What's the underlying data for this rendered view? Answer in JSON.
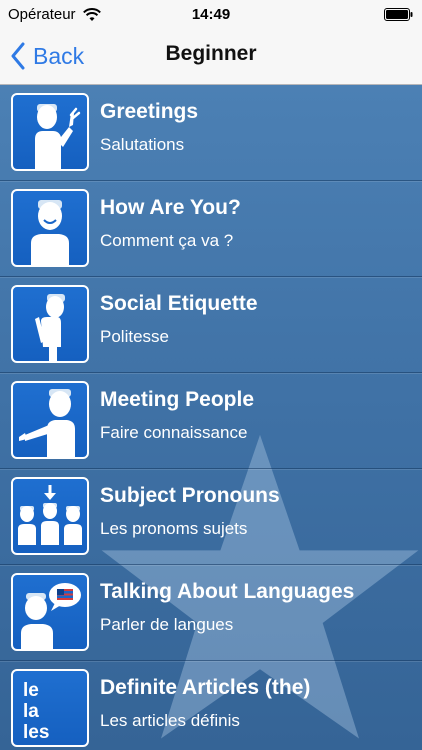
{
  "status_bar": {
    "carrier": "Opérateur",
    "time": "14:49"
  },
  "nav": {
    "back_label": "Back",
    "title": "Beginner"
  },
  "lessons": [
    {
      "title": "Greetings",
      "subtitle": "Salutations",
      "icon": "waving-person-icon"
    },
    {
      "title": "How Are You?",
      "subtitle": "Comment ça va ?",
      "icon": "smiling-person-icon"
    },
    {
      "title": "Social Etiquette",
      "subtitle": "Politesse",
      "icon": "bowing-person-icon"
    },
    {
      "title": "Meeting People",
      "subtitle": "Faire connaissance",
      "icon": "handshake-person-icon"
    },
    {
      "title": "Subject Pronouns",
      "subtitle": "Les pronoms sujets",
      "icon": "group-people-icon"
    },
    {
      "title": "Talking About Languages",
      "subtitle": "Parler de langues",
      "icon": "speech-flag-icon"
    },
    {
      "title": "Definite Articles (the)",
      "subtitle": "Les articles définis",
      "icon": "articles-text-icon"
    }
  ],
  "thumb_text": {
    "articles": [
      "le",
      "la",
      "les"
    ]
  },
  "colors": {
    "background": "#4a7eb3",
    "accent": "#2f7ae5",
    "thumb_blue": "#1a66c8"
  }
}
